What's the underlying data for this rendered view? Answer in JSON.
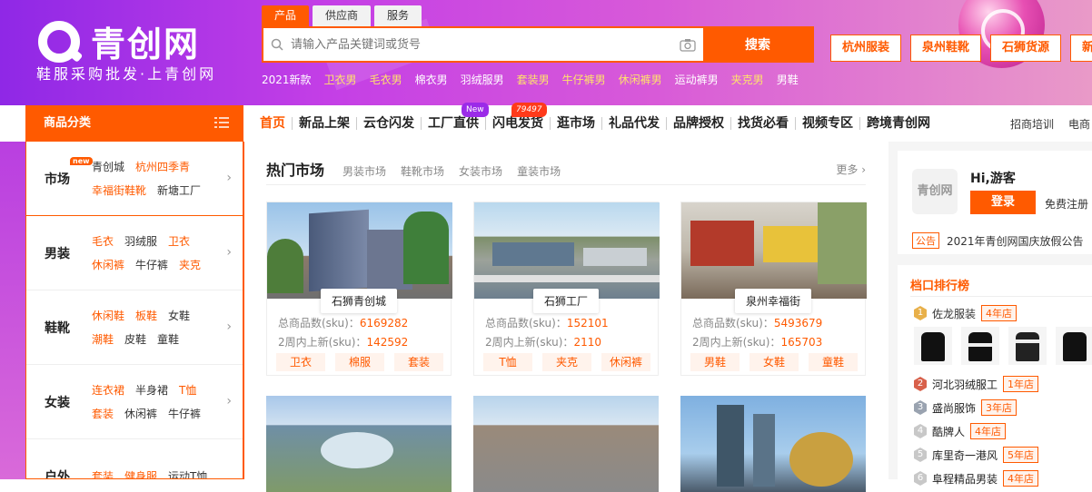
{
  "header": {
    "logo_text": "青创网",
    "slogan": "鞋服采购批发·上青创网",
    "search_tabs": [
      "产品",
      "供应商",
      "服务"
    ],
    "search_placeholder": "请输入产品关键词或货号",
    "search_button": "搜索",
    "hot_words": [
      {
        "text": "2021新款",
        "hl": false
      },
      {
        "text": "卫衣男",
        "hl": true
      },
      {
        "text": "毛衣男",
        "hl": true
      },
      {
        "text": "棉衣男",
        "hl": false
      },
      {
        "text": "羽绒服男",
        "hl": false
      },
      {
        "text": "套装男",
        "hl": true
      },
      {
        "text": "牛仔裤男",
        "hl": true
      },
      {
        "text": "休闲裤男",
        "hl": true
      },
      {
        "text": "运动裤男",
        "hl": false
      },
      {
        "text": "夹克男",
        "hl": true
      },
      {
        "text": "男鞋",
        "hl": false
      }
    ],
    "quick_buttons": [
      "杭州服装",
      "泉州鞋靴",
      "石狮货源",
      "新塘工厂"
    ]
  },
  "nav": {
    "category_header": "商品分类",
    "items": [
      "首页",
      "新品上架",
      "云仓闪发",
      "工厂直供",
      "闪电发货",
      "逛市场",
      "礼品代发",
      "品牌授权",
      "找货必看",
      "视频专区",
      "跨境青创网"
    ],
    "badge_new": "New",
    "badge_count": "79497",
    "right_links": [
      "招商培训",
      "电商"
    ]
  },
  "categories": [
    {
      "title": "市场",
      "new_badge": "new",
      "links": [
        {
          "t": "青创城",
          "hl": false
        },
        {
          "t": "杭州四季青",
          "hl": true
        },
        {
          "t": "幸福街鞋靴",
          "hl": true
        },
        {
          "t": "新塘工厂",
          "hl": false
        }
      ]
    },
    {
      "title": "男装",
      "links": [
        {
          "t": "毛衣",
          "hl": true
        },
        {
          "t": "羽绒服",
          "hl": false
        },
        {
          "t": "卫衣",
          "hl": true
        },
        {
          "t": "休闲裤",
          "hl": true
        },
        {
          "t": "牛仔裤",
          "hl": false
        },
        {
          "t": "夹克",
          "hl": true
        }
      ]
    },
    {
      "title": "鞋靴",
      "links": [
        {
          "t": "休闲鞋",
          "hl": true
        },
        {
          "t": "板鞋",
          "hl": true
        },
        {
          "t": "女鞋",
          "hl": false
        },
        {
          "t": "潮鞋",
          "hl": true
        },
        {
          "t": "皮鞋",
          "hl": false
        },
        {
          "t": "童鞋",
          "hl": false
        }
      ]
    },
    {
      "title": "女装",
      "links": [
        {
          "t": "连衣裙",
          "hl": true
        },
        {
          "t": "半身裙",
          "hl": false
        },
        {
          "t": "T恤",
          "hl": true
        },
        {
          "t": "套装",
          "hl": true
        },
        {
          "t": "休闲裤",
          "hl": false
        },
        {
          "t": "牛仔裤",
          "hl": false
        }
      ]
    },
    {
      "title": "户外",
      "links": [
        {
          "t": "套装",
          "hl": true
        },
        {
          "t": "健身服",
          "hl": true
        },
        {
          "t": "运动T恤",
          "hl": false
        }
      ]
    }
  ],
  "market": {
    "title": "热门市场",
    "tabs": [
      "男装市场",
      "鞋靴市场",
      "女装市场",
      "童装市场"
    ],
    "more": "更多",
    "sku_label": "总商品数(sku)：",
    "new_label": "2周内上新(sku)：",
    "cards": [
      {
        "name": "石狮青创城",
        "total": "6169282",
        "new": "142592",
        "tags": [
          "卫衣",
          "棉服",
          "套装"
        ]
      },
      {
        "name": "石狮工厂",
        "total": "152101",
        "new": "2110",
        "tags": [
          "T恤",
          "夹克",
          "休闲裤"
        ]
      },
      {
        "name": "泉州幸福街",
        "total": "5493679",
        "new": "165703",
        "tags": [
          "男鞋",
          "女鞋",
          "童鞋"
        ]
      }
    ]
  },
  "user": {
    "avatar_text": "青创网",
    "greeting": "Hi,游客",
    "login": "登录",
    "register": "免费注册",
    "notice_tag": "公告",
    "notice_text": "2021年青创网国庆放假公告"
  },
  "ranking": {
    "title": "档口排行榜",
    "items": [
      {
        "rank": "1",
        "name": "佐龙服装",
        "years": "4年店"
      },
      {
        "rank": "2",
        "name": "河北羽绒服工",
        "years": "1年店"
      },
      {
        "rank": "3",
        "name": "盛尚服饰",
        "years": "3年店"
      },
      {
        "rank": "4",
        "name": "酷牌人",
        "years": "4年店"
      },
      {
        "rank": "5",
        "name": "库里奇一港风",
        "years": "5年店"
      },
      {
        "rank": "6",
        "name": "阜程精品男装",
        "years": "4年店"
      }
    ]
  },
  "colors": {
    "brand": "#ff5a00",
    "header_gradient_start": "#8f28e6",
    "header_gradient_end": "#e99ac8"
  }
}
